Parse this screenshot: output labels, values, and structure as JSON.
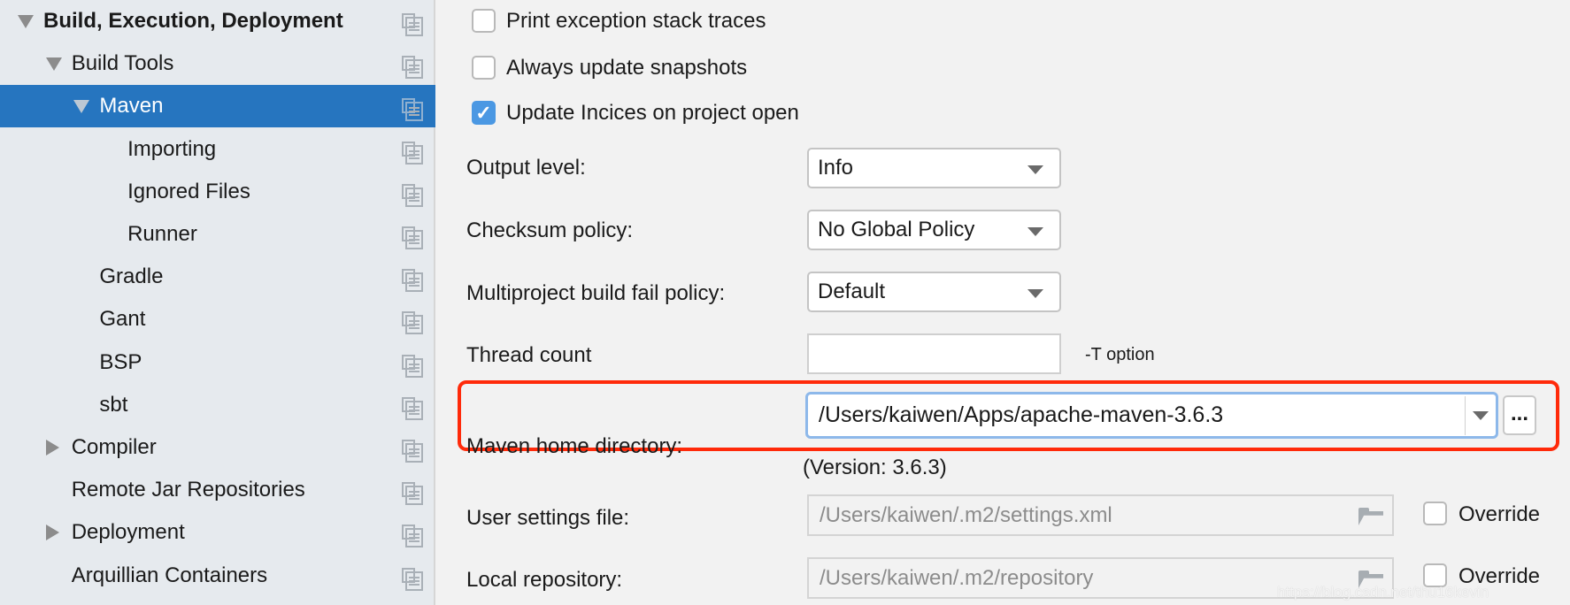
{
  "sidebar": {
    "items": [
      {
        "label": "Build, Execution, Deployment",
        "bold": true,
        "expander": "expanded"
      },
      {
        "label": "Build Tools",
        "expander": "expanded"
      },
      {
        "label": "Maven",
        "expander": "expanded",
        "selected": true
      },
      {
        "label": "Importing"
      },
      {
        "label": "Ignored Files"
      },
      {
        "label": "Runner"
      },
      {
        "label": "Gradle"
      },
      {
        "label": "Gant"
      },
      {
        "label": "BSP"
      },
      {
        "label": "sbt"
      },
      {
        "label": "Compiler",
        "expander": "collapsed"
      },
      {
        "label": "Remote Jar Repositories"
      },
      {
        "label": "Deployment",
        "expander": "collapsed"
      },
      {
        "label": "Arquillian Containers"
      }
    ],
    "selected_color": "#2675bf"
  },
  "checkboxes": [
    {
      "label": "Print exception stack traces",
      "checked": false
    },
    {
      "label": "Always update snapshots",
      "checked": false
    },
    {
      "label": "Update Incices on project open",
      "checked": true
    }
  ],
  "fields": {
    "output_level": {
      "label": "Output level:",
      "value": "Info"
    },
    "checksum_policy": {
      "label": "Checksum policy:",
      "value": "No Global Policy"
    },
    "fail_policy": {
      "label": "Multiproject build fail policy:",
      "value": "Default"
    },
    "thread_count": {
      "label": "Thread count",
      "value": "",
      "hint": "-T option"
    },
    "maven_home": {
      "label": "Maven home directory:",
      "value": "/Users/kaiwen/Apps/apache-maven-3.6.3",
      "browse": "...",
      "version": "(Version: 3.6.3)"
    },
    "user_settings": {
      "label": "User settings file:",
      "value": "/Users/kaiwen/.m2/settings.xml",
      "override": "Override",
      "override_checked": false
    },
    "local_repo": {
      "label": "Local repository:",
      "value": "/Users/kaiwen/.m2/repository",
      "override": "Override",
      "override_checked": false
    }
  },
  "highlight_color": "#ff2a0a",
  "watermark": "https://blog.csdn.net/thu16kevin"
}
